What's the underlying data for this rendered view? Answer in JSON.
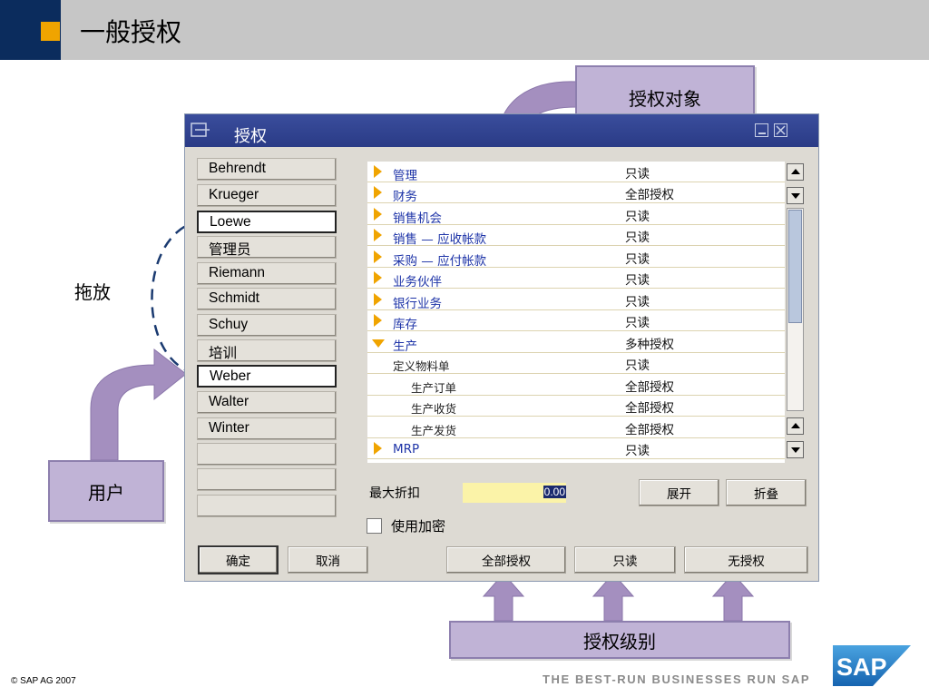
{
  "slide": {
    "title": "一般授权",
    "callout_auth_object": "授权对象",
    "callout_drag": "拖放",
    "callout_user": "用户",
    "callout_auth_level": "授权级别",
    "footer_copyright": "© SAP AG 2007",
    "footer_tagline": "THE BEST-RUN BUSINESSES RUN SAP",
    "logo_text": "SAP"
  },
  "window": {
    "title": "授权"
  },
  "users": [
    "Behrendt",
    "Krueger",
    "Loewe",
    "管理员",
    "Riemann",
    "Schmidt",
    "Schuy",
    "培训",
    "Weber",
    "Walter",
    "Winter",
    "",
    "",
    ""
  ],
  "selected_users": [
    "Loewe",
    "Weber"
  ],
  "auth_rows": [
    {
      "name": "管理",
      "value": "只读",
      "icon": "collapsed"
    },
    {
      "name": "财务",
      "value": "全部授权",
      "icon": "collapsed"
    },
    {
      "name": "销售机会",
      "value": "只读",
      "icon": "collapsed"
    },
    {
      "name": "销售 — 应收帐款",
      "value": "只读",
      "icon": "collapsed"
    },
    {
      "name": "采购 — 应付帐款",
      "value": "只读",
      "icon": "collapsed"
    },
    {
      "name": "业务伙伴",
      "value": "只读",
      "icon": "collapsed"
    },
    {
      "name": "银行业务",
      "value": "只读",
      "icon": "collapsed"
    },
    {
      "name": "库存",
      "value": "只读",
      "icon": "collapsed"
    },
    {
      "name": "生产",
      "value": "多种授权",
      "icon": "expanded"
    },
    {
      "name": "定义物料单",
      "value": "只读",
      "icon": "none",
      "level": 1
    },
    {
      "name": "生产订单",
      "value": "全部授权",
      "icon": "none",
      "level": 2
    },
    {
      "name": "生产收货",
      "value": "全部授权",
      "icon": "none",
      "level": 2
    },
    {
      "name": "生产发货",
      "value": "全部授权",
      "icon": "none",
      "level": 2
    },
    {
      "name": "MRP",
      "value": "只读",
      "icon": "collapsed"
    }
  ],
  "max_discount": {
    "label": "最大折扣",
    "value": "0.00"
  },
  "expand_label": "展开",
  "collapse_label": "折叠",
  "encryption": {
    "label": "使用加密",
    "checked": false
  },
  "buttons": {
    "ok": "确定",
    "cancel": "取消",
    "full_auth": "全部授权",
    "read_only": "只读",
    "no_auth": "无授权"
  },
  "colors": {
    "accent_orange": "#f0a400",
    "header_navy": "#0b2c5d",
    "title_bar": "#2f418e",
    "callout_purple": "#c0b3d6"
  }
}
